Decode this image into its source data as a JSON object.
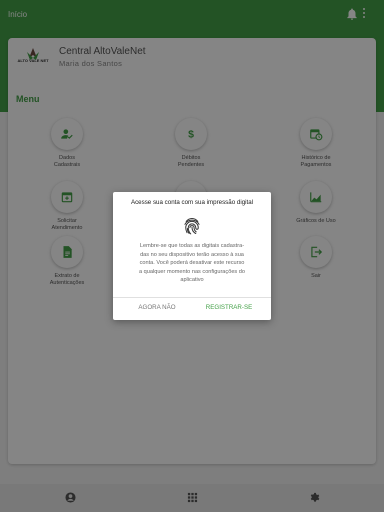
{
  "appbar": {
    "title": "Início"
  },
  "header": {
    "logo_text": "ALTO VALE NET",
    "brand_name": "Central AltoValeNet",
    "user_name": "Maria dos Santos"
  },
  "menu": {
    "title": "Menu",
    "items": [
      {
        "label": "Dados\nCadastrais",
        "icon": "user-check-icon"
      },
      {
        "label": "Débitos\nPendentes",
        "icon": "dollar-icon"
      },
      {
        "label": "Histórico de\nPagamentos",
        "icon": "calendar-clock-icon"
      },
      {
        "label": "Solicitar\nAtendimento",
        "icon": "calendar-plus-icon"
      },
      {
        "label": "",
        "icon": "circle-icon"
      },
      {
        "label": "Gráficos de Uso",
        "icon": "area-chart-icon"
      },
      {
        "label": "Extrato de\nAutenticações",
        "icon": "document-icon"
      },
      {
        "label": "Sair",
        "icon": "logout-icon"
      }
    ]
  },
  "dialog": {
    "title": "Acesse sua conta com sua impressão digital",
    "body": "Lembre-se que todas as digitais cadastra-\ndas no seu dispositivo terão acesso à sua\nconta. Você poderá desativar este recurso\na qualquer momento nas configurações do\naplicativo",
    "decline_label": "AGORA NÃO",
    "accept_label": "REGISTRAR-SE"
  },
  "bottom_nav": {
    "items": [
      {
        "icon": "account-icon"
      },
      {
        "icon": "apps-grid-icon"
      },
      {
        "icon": "settings-gear-icon"
      }
    ]
  },
  "colors": {
    "primary": "#43a047",
    "overlay": "rgba(0,0,0,0.48)"
  }
}
